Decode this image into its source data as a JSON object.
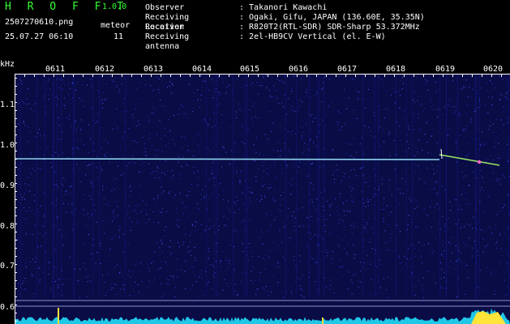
{
  "app": {
    "title": "H R O F F T",
    "version": "1.0.0"
  },
  "file": {
    "name": "2507270610.png",
    "datetime": "25.07.27 06:10"
  },
  "meteor": {
    "label": "meteor",
    "count": "11"
  },
  "info": [
    {
      "label": "Observer",
      "value": ": Takanori Kawachi"
    },
    {
      "label": "Receiving Location",
      "value": ": Ogaki, Gifu, JAPAN (136.60E, 35.35N)"
    },
    {
      "label": "Receiver",
      "value": ": R820T2(RTL-SDR) SDR-Sharp 53.372MHz"
    },
    {
      "label": "Receiving antenna",
      "value": ": 2el-HB9CV Vertical (el. E-W)"
    }
  ],
  "axes": {
    "y_unit": "kHz",
    "y_ticks": [
      "1.1",
      "1.0",
      "0.9",
      "0.8",
      "0.7",
      "0.6"
    ],
    "x_ticks": [
      "0611",
      "0612",
      "0613",
      "0614",
      "0615",
      "0616",
      "0617",
      "0618",
      "0619",
      "0620"
    ]
  },
  "colors": {
    "title": "#33ff33",
    "background": "#000000",
    "plot": "#0a0c46",
    "trace": "#9be7ff",
    "meteor": "#ff66cc"
  }
}
